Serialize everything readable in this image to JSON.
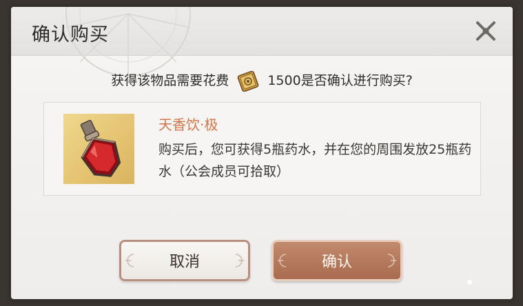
{
  "dialog": {
    "title": "确认购买",
    "prompt_before": "获得该物品需要花费",
    "cost": "1500",
    "prompt_after": "是否确认进行购买?",
    "currency_icon": "currency-token-icon",
    "close_icon": "close-icon"
  },
  "item": {
    "name": "天香饮·极",
    "description": "购买后，您可获得5瓶药水，并在您的周围发放25瓶药水（公会成员可拾取）",
    "icon": "red-potion-bottle-icon"
  },
  "buttons": {
    "cancel_label": "取消",
    "confirm_label": "确认"
  },
  "colors": {
    "item_name": "#d0744a",
    "confirm_button": "#a86b4f",
    "cancel_button_border": "#b78f7c"
  }
}
